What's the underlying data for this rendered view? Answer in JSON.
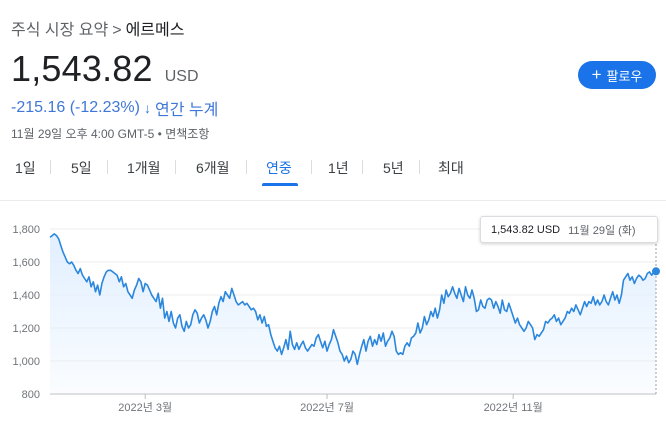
{
  "breadcrumb": {
    "root": "주식 시장 요약",
    "separator": ">",
    "current": "에르메스"
  },
  "quote": {
    "price": "1,543.82",
    "currency": "USD"
  },
  "follow_button": {
    "label": "팔로우",
    "icon": "plus-icon"
  },
  "change": {
    "text": "-215.16 (-12.23%)",
    "arrow": "↓",
    "period": "연간 누계",
    "color": "#3f77d8"
  },
  "meta": "11월 29일 오후 4:00 GMT-5 • 면책조항",
  "tabs": [
    {
      "label": "1일",
      "active": false
    },
    {
      "label": "5일",
      "active": false
    },
    {
      "label": "1개월",
      "active": false
    },
    {
      "label": "6개월",
      "active": false
    },
    {
      "label": "연중",
      "active": true
    },
    {
      "label": "1년",
      "active": false
    },
    {
      "label": "5년",
      "active": false
    },
    {
      "label": "최대",
      "active": false
    }
  ],
  "tooltip": {
    "value": "1,543.82 USD",
    "date": "11월 29일 (화)"
  },
  "colors": {
    "accent": "#1a73e8",
    "line": "#2b87dd",
    "fill": "#e1efff"
  },
  "chart_data": {
    "type": "area",
    "ylim": [
      800,
      1800
    ],
    "yticks": [
      "1,800",
      "1,600",
      "1,400",
      "1,200",
      "1,000",
      "800"
    ],
    "xticks": [
      {
        "label": "2022년 3월",
        "index": 44
      },
      {
        "label": "2022년 7월",
        "index": 128
      },
      {
        "label": "2022년 11월",
        "index": 214
      }
    ],
    "values": [
      1750,
      1760,
      1770,
      1760,
      1740,
      1700,
      1660,
      1630,
      1600,
      1590,
      1600,
      1580,
      1550,
      1530,
      1560,
      1520,
      1500,
      1480,
      1510,
      1450,
      1480,
      1420,
      1460,
      1400,
      1470,
      1510,
      1540,
      1550,
      1550,
      1540,
      1530,
      1520,
      1480,
      1510,
      1450,
      1470,
      1420,
      1400,
      1380,
      1430,
      1460,
      1500,
      1480,
      1420,
      1470,
      1460,
      1430,
      1400,
      1380,
      1360,
      1410,
      1320,
      1380,
      1260,
      1300,
      1240,
      1300,
      1230,
      1200,
      1260,
      1280,
      1210,
      1180,
      1240,
      1200,
      1220,
      1280,
      1310,
      1290,
      1230,
      1260,
      1280,
      1250,
      1200,
      1240,
      1300,
      1330,
      1280,
      1350,
      1390,
      1360,
      1420,
      1400,
      1380,
      1440,
      1400,
      1360,
      1340,
      1350,
      1360,
      1340,
      1350,
      1330,
      1310,
      1320,
      1300,
      1250,
      1280,
      1230,
      1270,
      1210,
      1220,
      1160,
      1120,
      1080,
      1060,
      1090,
      1040,
      1080,
      1130,
      1070,
      1180,
      1100,
      1070,
      1110,
      1070,
      1100,
      1120,
      1080,
      1060,
      1080,
      1100,
      1090,
      1140,
      1160,
      1120,
      1080,
      1120,
      1060,
      1100,
      1130,
      1190,
      1150,
      1110,
      1060,
      1040,
      1000,
      1030,
      990,
      1010,
      1060,
      1040,
      980,
      1040,
      1090,
      1130,
      1060,
      1120,
      1150,
      1090,
      1130,
      1100,
      1160,
      1120,
      1170,
      1090,
      1120,
      1140,
      1180,
      1150,
      1060,
      1040,
      1050,
      1040,
      1090,
      1110,
      1090,
      1140,
      1150,
      1170,
      1230,
      1170,
      1200,
      1270,
      1220,
      1250,
      1300,
      1270,
      1320,
      1260,
      1310,
      1400,
      1350,
      1430,
      1390,
      1410,
      1450,
      1410,
      1380,
      1440,
      1400,
      1360,
      1450,
      1400,
      1380,
      1430,
      1380,
      1300,
      1310,
      1370,
      1330,
      1320,
      1370,
      1380,
      1370,
      1320,
      1360,
      1330,
      1290,
      1370,
      1310,
      1300,
      1350,
      1310,
      1270,
      1230,
      1260,
      1220,
      1200,
      1180,
      1200,
      1240,
      1220,
      1200,
      1130,
      1160,
      1150,
      1170,
      1190,
      1240,
      1230,
      1250,
      1260,
      1280,
      1240,
      1260,
      1220,
      1240,
      1260,
      1300,
      1290,
      1320,
      1300,
      1340,
      1310,
      1280,
      1320,
      1360,
      1330,
      1360,
      1350,
      1390,
      1340,
      1370,
      1340,
      1360,
      1400,
      1360,
      1340,
      1380,
      1420,
      1370,
      1400,
      1350,
      1400,
      1490,
      1510,
      1530,
      1490,
      1510,
      1470,
      1500,
      1520,
      1510,
      1490,
      1500,
      1530,
      1540,
      1520,
      1540,
      1543.82
    ]
  }
}
